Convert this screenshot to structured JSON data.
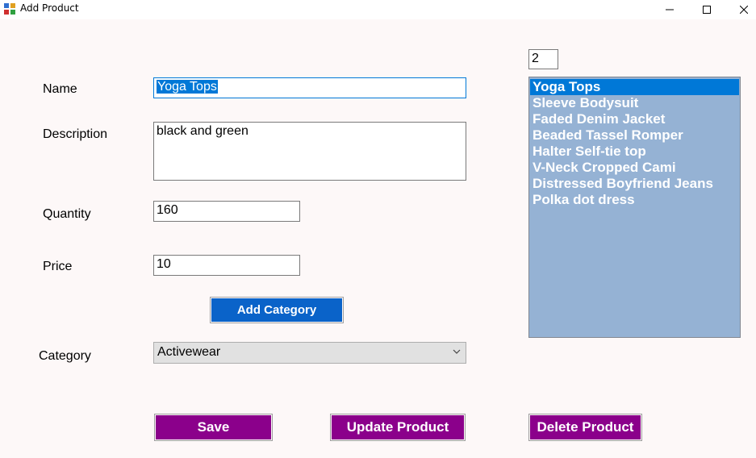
{
  "window": {
    "title": "Add Product",
    "controls": [
      "minimize-icon",
      "maximize-icon",
      "close-icon"
    ]
  },
  "form": {
    "name_label": "Name",
    "name_value": "Yoga Tops",
    "description_label": "Description",
    "description_value": "black and green",
    "quantity_label": "Quantity",
    "quantity_value": "160",
    "price_label": "Price",
    "price_value": "10",
    "add_category_label": "Add Category",
    "category_label": "Category",
    "category_value": "Activewear"
  },
  "id_box": {
    "value": "2"
  },
  "product_list": {
    "items": [
      "Yoga Tops",
      "Sleeve Bodysuit",
      "Faded Denim Jacket",
      "Beaded Tassel Romper",
      "Halter Self-tie top",
      "V-Neck Cropped Cami",
      "Distressed Boyfriend Jeans",
      "Polka dot dress"
    ],
    "selected": 0
  },
  "actions": {
    "save_label": "Save",
    "update_label": "Update Product",
    "delete_label": "Delete Product"
  },
  "colors": {
    "action_button": "#8b008b",
    "add_button": "#0a63c9",
    "list_background": "#95b2d4",
    "selection": "#0078d7"
  }
}
